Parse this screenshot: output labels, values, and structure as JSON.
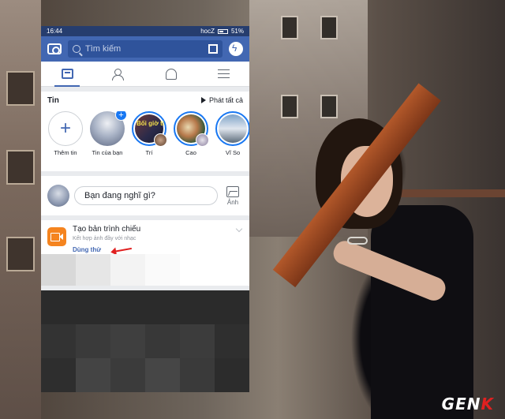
{
  "status_bar": {
    "time": "16:44",
    "carrier": "hocZ",
    "battery": "51%"
  },
  "search": {
    "placeholder": "Tìm kiếm"
  },
  "tabs": [
    {
      "name": "news-feed-icon",
      "active": true
    },
    {
      "name": "friends-icon",
      "active": false
    },
    {
      "name": "notifications-bell-icon",
      "active": false
    },
    {
      "name": "menu-icon",
      "active": false
    }
  ],
  "stories": {
    "title": "Tin",
    "play_all": "Phát tất cả",
    "items": [
      {
        "label": "Thêm tin",
        "type": "add"
      },
      {
        "label": "Tin của bạn",
        "type": "own"
      },
      {
        "label": "Trí",
        "overlay": "Bối giờ ti"
      },
      {
        "label": "Cao"
      },
      {
        "label": "Vĩ So"
      }
    ]
  },
  "composer": {
    "placeholder": "Bạn đang nghĩ gì?",
    "photo_label": "Ảnh"
  },
  "slideshow": {
    "title": "Tạo bản trình chiếu",
    "subtitle": "Kết hợp ảnh đầy với nhạc",
    "action": "Dùng thử"
  },
  "watermark": {
    "prefix": "GEN",
    "suffix": "K"
  },
  "colors": {
    "facebook_blue": "#4267b2",
    "status_bar": "#263d6e",
    "accent_orange": "#f5841f",
    "arrow_red": "#e02020"
  }
}
